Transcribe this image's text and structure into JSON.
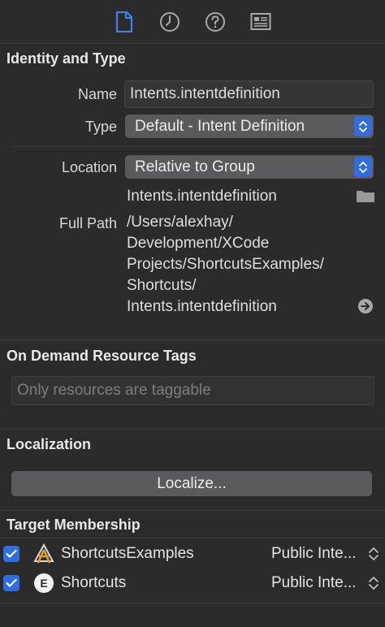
{
  "toolbar": {
    "tabs": [
      {
        "name": "file-inspector-icon",
        "active": true
      },
      {
        "name": "history-inspector-icon",
        "active": false
      },
      {
        "name": "quick-help-icon",
        "active": false
      },
      {
        "name": "identity-inspector-icon",
        "active": false
      }
    ]
  },
  "identity": {
    "header": "Identity and Type",
    "name_label": "Name",
    "name_value": "Intents.intentdefinition",
    "type_label": "Type",
    "type_value": "Default - Intent Definition",
    "location_label": "Location",
    "location_value": "Relative to Group",
    "location_file": "Intents.intentdefinition",
    "full_path_label": "Full Path",
    "full_path_lines": [
      "/Users/alexhay/",
      "Development/XCode",
      "Projects/ShortcutsExamples/",
      "Shortcuts/",
      "Intents.intentdefinition"
    ]
  },
  "on_demand": {
    "header": "On Demand Resource Tags",
    "placeholder": "Only resources are taggable"
  },
  "localization": {
    "header": "Localization",
    "button_label": "Localize..."
  },
  "target_membership": {
    "header": "Target Membership",
    "targets": [
      {
        "name": "ShortcutsExamples",
        "checked": true,
        "icon": "app-target-icon",
        "visibility": "Public Inte..."
      },
      {
        "name": "Shortcuts",
        "checked": true,
        "icon": "extension-target-icon",
        "visibility": "Public Inte..."
      }
    ]
  },
  "colors": {
    "accent": "#2f6de0",
    "background": "#2b2b2c"
  }
}
